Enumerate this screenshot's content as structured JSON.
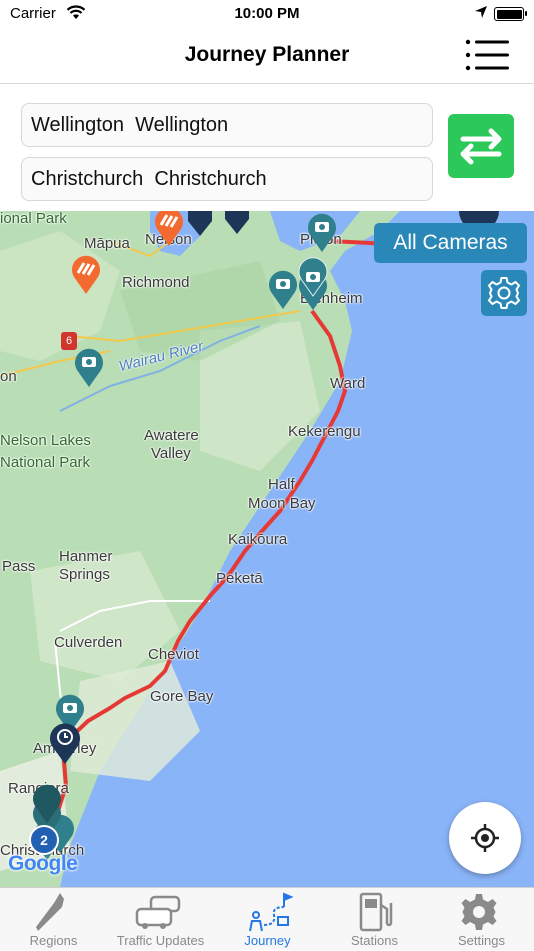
{
  "status_bar": {
    "carrier": "Carrier",
    "time": "10:00 PM"
  },
  "header": {
    "title": "Journey Planner",
    "menu_icon": "hamburger-menu-icon"
  },
  "route": {
    "from_value": "Wellington  Wellington",
    "to_value": "Christchurch  Christchurch",
    "swap_icon": "swap-arrows-icon",
    "swap_color": "#2dc85a"
  },
  "map": {
    "all_cameras_label": "All Cameras",
    "route_color": "#e53935",
    "button_color": "#2a88b8",
    "cluster_count": "2",
    "attribution": "Google",
    "labels": {
      "national_park": "ional Park",
      "mapua": "Māpua",
      "nelson": "Nelson",
      "richmond": "Richmond",
      "picton": "Picton",
      "blenheim": "Blenheim",
      "wairau_river": "Wairau River",
      "highway_6": "6",
      "on": "on",
      "ward": "Ward",
      "nelson_lakes_1": "Nelson Lakes",
      "nelson_lakes_2": "National Park",
      "awatere_1": "Awatere",
      "awatere_2": "Valley",
      "kekerengu": "Kekerengu",
      "half_moon_1": "Half",
      "half_moon_2": "Moon Bay",
      "kaikoura": "Kaikōura",
      "pass": "Pass",
      "hanmer_1": "Hanmer",
      "hanmer_2": "Springs",
      "peketa": "Peketā",
      "culverden": "Culverden",
      "cheviot": "Cheviot",
      "gore_bay": "Gore Bay",
      "amberley": "Amberley",
      "rangiora": "Rangiora",
      "christchurch": "Christchurch"
    }
  },
  "tabs": [
    {
      "label": "Regions",
      "icon": "nz-map-icon",
      "active": false
    },
    {
      "label": "Traffic Updates",
      "icon": "cars-icon",
      "active": false
    },
    {
      "label": "Journey",
      "icon": "journey-route-icon",
      "active": true
    },
    {
      "label": "Stations",
      "icon": "fuel-station-icon",
      "active": false
    },
    {
      "label": "Settings",
      "icon": "gear-icon",
      "active": false
    }
  ],
  "colors": {
    "active_tab": "#2577e6",
    "inactive_tab": "#8a8a8a"
  }
}
